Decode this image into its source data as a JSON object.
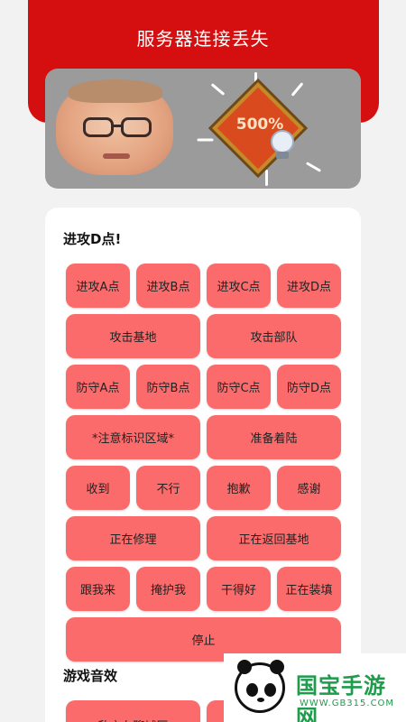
{
  "header": {
    "title": "服务器连接丢失"
  },
  "banner": {
    "badge_text": "500%"
  },
  "voice": {
    "title": "进攻D点!",
    "rows": [
      [
        "进攻A点",
        "进攻B点",
        "进攻C点",
        "进攻D点"
      ],
      [
        "攻击基地",
        "攻击部队"
      ],
      [
        "防守A点",
        "防守B点",
        "防守C点",
        "防守D点"
      ],
      [
        "*注意标识区域*",
        "准备着陆"
      ],
      [
        "收到",
        "不行",
        "抱歉",
        "感谢"
      ],
      [
        "正在修理",
        "正在返回基地"
      ],
      [
        "跟我来",
        "掩护我",
        "干得好",
        "正在装填"
      ],
      [
        "停止"
      ]
    ]
  },
  "sound": {
    "title": "游戏音效",
    "first_button": "敌方在聊城区"
  },
  "watermark": {
    "text": "国宝手游网",
    "url": "WWW.GB315.COM"
  },
  "colors": {
    "header": "#d50f0f",
    "button": "#fb6b6b",
    "background": "#f2f2f2"
  }
}
